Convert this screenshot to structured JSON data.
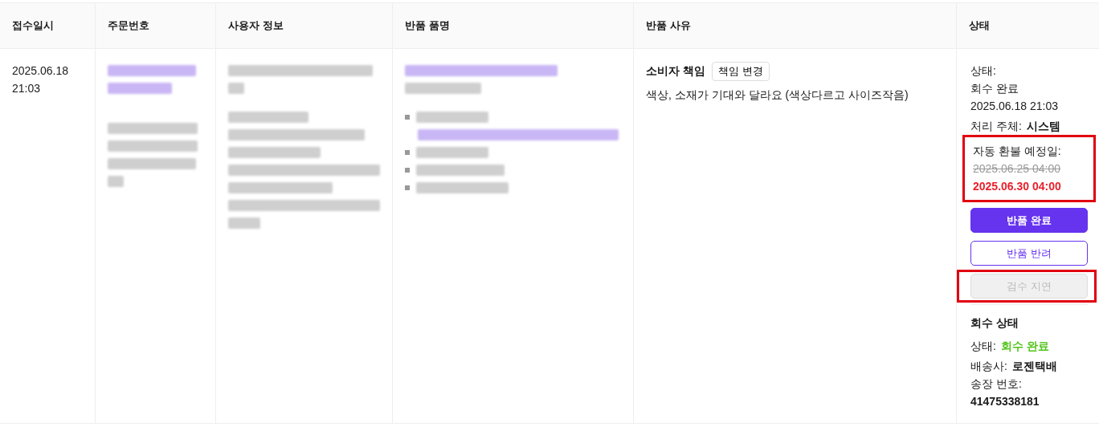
{
  "table": {
    "columns": [
      "접수일시",
      "주문번호",
      "사용자 정보",
      "반품 품명",
      "반품 사유",
      "상태"
    ],
    "rows": [
      {
        "received": [
          "2025.06.18",
          "21:03"
        ],
        "order_no": {
          "redacted": true
        },
        "user_info": {
          "redacted": true
        },
        "item": {
          "redacted": true
        },
        "reason": {
          "responsibility": "소비자 책임",
          "change_button": "책임 변경",
          "text": "색상, 소재가 기대와 달라요 (색상다르고 사이즈작음)"
        },
        "status": {
          "label": "상태:",
          "value": "회수 완료",
          "date": "2025.06.18 21:03",
          "handler_label": "처리 주체:",
          "handler": "시스템",
          "refund": {
            "highlighted": true,
            "label": "자동 환불 예정일:",
            "old_date": "2025.06.25 04:00",
            "new_date": "2025.06.30 04:00"
          },
          "buttons": [
            {
              "label": "반품 완료",
              "kind": "primary",
              "disabled": false,
              "highlighted": false
            },
            {
              "label": "반품 반려",
              "kind": "outline",
              "disabled": false,
              "highlighted": false
            },
            {
              "label": "검수 지연",
              "kind": "outline",
              "disabled": true,
              "highlighted": true
            }
          ],
          "pickup": {
            "title": "회수 상태",
            "fields": [
              {
                "label": "상태:",
                "value": "회수 완료",
                "color": "#52c41a"
              },
              {
                "label": "배송사:",
                "value": "로젠택배"
              }
            ],
            "tracking_label": "송장 번호:",
            "tracking_no": "41475338181"
          }
        }
      }
    ]
  }
}
